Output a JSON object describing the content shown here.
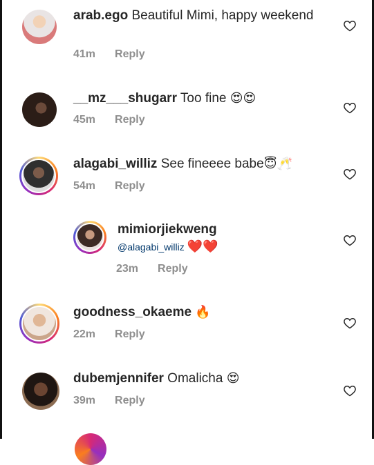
{
  "comments": [
    {
      "user": "arab.ego",
      "text": " Beautiful Mimi, happy weekend",
      "time": "41m",
      "reply": "Reply",
      "emoji": ""
    },
    {
      "user": "__mz___shugarr",
      "text": " Too fine ",
      "time": "45m",
      "reply": "Reply",
      "emoji": "😍😍"
    },
    {
      "user": "alagabi_williz",
      "text": " See fineeee babe",
      "time": "54m",
      "reply": "Reply",
      "emoji": "😇🥂"
    },
    {
      "user": "mimiorjiekweng",
      "text": "@alagabi_williz ",
      "time": "23m",
      "reply": "Reply",
      "emoji": "❤️❤️"
    },
    {
      "user": "goodness_okaeme",
      "text": " ",
      "time": "22m",
      "reply": "Reply",
      "emoji": "🔥"
    },
    {
      "user": "dubemjennifer",
      "text": " Omalicha ",
      "time": "39m",
      "reply": "Reply",
      "emoji": "😍"
    }
  ],
  "colors": {
    "accent": "#d62976",
    "meta": "#8e8e8e",
    "text": "#262626"
  }
}
